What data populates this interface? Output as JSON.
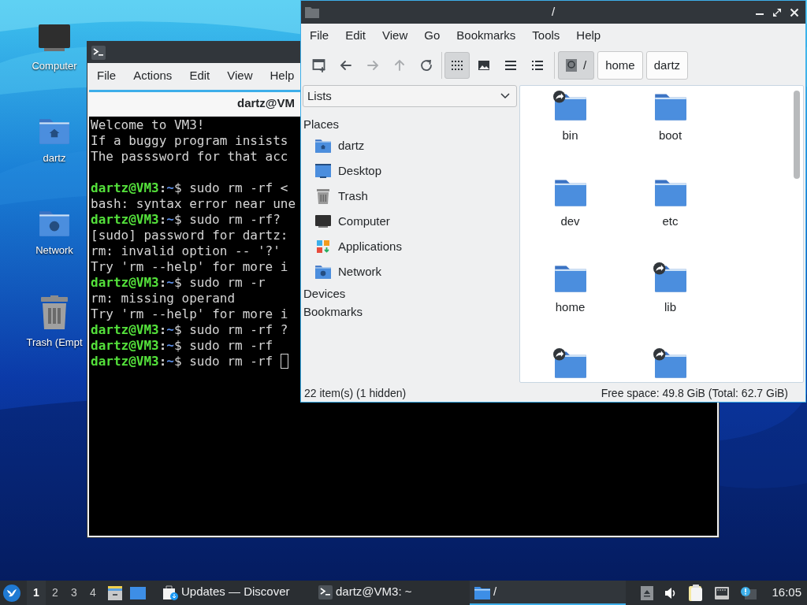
{
  "desktop_icons": [
    {
      "label": "Computer",
      "kind": "computer"
    },
    {
      "label": "dartz",
      "kind": "home"
    },
    {
      "label": "Network",
      "kind": "network"
    },
    {
      "label": "Trash (Empt",
      "kind": "trash"
    }
  ],
  "terminal": {
    "menu": [
      "File",
      "Actions",
      "Edit",
      "View",
      "Help"
    ],
    "tab_title": "dartz@VM",
    "lines": [
      {
        "kind": "output",
        "text": "Welcome to VM3!"
      },
      {
        "kind": "output",
        "text": "If a buggy program insists"
      },
      {
        "kind": "output",
        "text": "The passsword for that acc"
      },
      {
        "kind": "blank"
      },
      {
        "kind": "prompt",
        "user": "dartz@VM3",
        "colon": ":",
        "path": "~",
        "symbol": "$",
        "command": "sudo rm -rf <",
        "cursor": false
      },
      {
        "kind": "output",
        "text": "bash: syntax error near une"
      },
      {
        "kind": "prompt",
        "user": "dartz@VM3",
        "colon": ":",
        "path": "~",
        "symbol": "$",
        "command": "sudo rm -rf?",
        "cursor": false
      },
      {
        "kind": "output",
        "text": "[sudo] password for dartz:"
      },
      {
        "kind": "output",
        "text": "rm: invalid option -- '?'"
      },
      {
        "kind": "output",
        "text": "Try 'rm --help' for more i"
      },
      {
        "kind": "prompt",
        "user": "dartz@VM3",
        "colon": ":",
        "path": "~",
        "symbol": "$",
        "command": "sudo rm -r",
        "cursor": false
      },
      {
        "kind": "output",
        "text": "rm: missing operand"
      },
      {
        "kind": "output",
        "text": "Try 'rm --help' for more i"
      },
      {
        "kind": "prompt",
        "user": "dartz@VM3",
        "colon": ":",
        "path": "~",
        "symbol": "$",
        "command": "sudo rm -rf ?",
        "cursor": false
      },
      {
        "kind": "prompt",
        "user": "dartz@VM3",
        "colon": ":",
        "path": "~",
        "symbol": "$",
        "command": "sudo rm -rf",
        "cursor": false
      },
      {
        "kind": "prompt",
        "user": "dartz@VM3",
        "colon": ":",
        "path": "~",
        "symbol": "$",
        "command": "sudo rm -rf",
        "cursor": true
      }
    ]
  },
  "file_manager": {
    "title": "/",
    "menu": [
      "File",
      "Edit",
      "View",
      "Go",
      "Bookmarks",
      "Tools",
      "Help"
    ],
    "nav_buttons": [
      {
        "kind": "new_window",
        "disabled": false
      },
      {
        "kind": "back",
        "disabled": false
      },
      {
        "kind": "forward",
        "disabled": true
      },
      {
        "kind": "up",
        "disabled": true
      },
      {
        "kind": "reload",
        "disabled": false
      }
    ],
    "view_modes": [
      {
        "kind": "icons",
        "selected": true
      },
      {
        "kind": "thumbnails",
        "selected": false
      },
      {
        "kind": "compact",
        "selected": false
      },
      {
        "kind": "details",
        "selected": false
      }
    ],
    "path": [
      {
        "label": "/",
        "selected": true
      },
      {
        "label": "home",
        "selected": false
      },
      {
        "label": "dartz",
        "selected": false
      }
    ],
    "sidebar": {
      "mode": "Lists",
      "sections": [
        {
          "label": "Places",
          "items": [
            {
              "label": "dartz",
              "kind": "home"
            },
            {
              "label": "Desktop",
              "kind": "desktop"
            },
            {
              "label": "Trash",
              "kind": "trash"
            },
            {
              "label": "Computer",
              "kind": "computer"
            },
            {
              "label": "Applications",
              "kind": "applications"
            },
            {
              "label": "Network",
              "kind": "network"
            }
          ]
        },
        {
          "label": "Devices"
        },
        {
          "label": "Bookmarks"
        }
      ]
    },
    "files": [
      {
        "name": "bin",
        "symlink": true
      },
      {
        "name": "boot",
        "symlink": false
      },
      {
        "name": "dev",
        "symlink": false
      },
      {
        "name": "etc",
        "symlink": false
      },
      {
        "name": "home",
        "symlink": false
      },
      {
        "name": "lib",
        "symlink": true
      },
      {
        "symlink": true
      },
      {
        "symlink": true
      }
    ],
    "status": {
      "items": "22 item(s) (1 hidden)",
      "space": "Free space: 49.8 GiB (Total: 62.7 GiB)"
    }
  },
  "taskbar": {
    "workspaces": [
      {
        "label": "1",
        "selected": true
      },
      {
        "label": "2",
        "selected": false
      },
      {
        "label": "3",
        "selected": false
      },
      {
        "label": "4",
        "selected": false
      }
    ],
    "launchers": [
      {
        "kind": "cabinet"
      },
      {
        "kind": "desktop"
      }
    ],
    "tasks": [
      {
        "label": "Updates — Discover",
        "kind": "discover",
        "selected": false
      },
      {
        "label": "dartz@VM3: ~",
        "kind": "terminal",
        "selected": false
      },
      {
        "label": "/",
        "kind": "folder",
        "selected": true
      }
    ],
    "tray": [
      {
        "kind": "eject"
      },
      {
        "kind": "volume"
      },
      {
        "kind": "clipboard"
      },
      {
        "kind": "network"
      },
      {
        "kind": "notification"
      }
    ],
    "clock": "16:05"
  }
}
